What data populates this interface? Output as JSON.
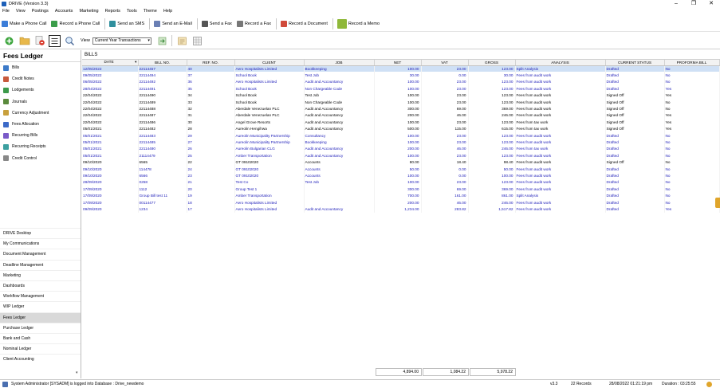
{
  "window": {
    "title": "DRIVE (Version 3.3)"
  },
  "menu": [
    "File",
    "View",
    "Postings",
    "Accounts",
    "Marketing",
    "Reports",
    "Tools",
    "Theme",
    "Help"
  ],
  "toolbar": [
    {
      "label": "Make a Phone Call",
      "icon": "phone-icon",
      "color": "#3b7dd8"
    },
    {
      "label": "Record a Phone Call",
      "icon": "phone-record-icon",
      "color": "#3b9d4a"
    },
    {
      "label": "Send an SMS",
      "icon": "sms-icon",
      "color": "#2f8f9d"
    },
    {
      "label": "Send an E-Mail",
      "icon": "email-icon",
      "color": "#6a7fb4"
    },
    {
      "label": "Send a Fax",
      "icon": "fax-icon",
      "color": "#555555"
    },
    {
      "label": "Record a Fax",
      "icon": "fax-record-icon",
      "color": "#777777"
    },
    {
      "label": "Record a Document",
      "icon": "document-icon",
      "color": "#d04a3a"
    },
    {
      "label": "Record a Memo",
      "icon": "memo-icon",
      "color": "#8fb83a"
    }
  ],
  "view": {
    "label": "View",
    "selected": "Current Year Transactions"
  },
  "sidebar": {
    "title": "Fees Ledger",
    "items": [
      {
        "label": "Bills",
        "icon": "bills-icon",
        "color": "#3c7ac8"
      },
      {
        "label": "Credit Notes",
        "icon": "credit-notes-icon",
        "color": "#c85a3c"
      },
      {
        "label": "Lodgements",
        "icon": "lodgements-icon",
        "color": "#3c9a4a"
      },
      {
        "label": "Journals",
        "icon": "journals-icon",
        "color": "#5a8a3c"
      },
      {
        "label": "Currency Adjustment",
        "icon": "currency-icon",
        "color": "#c8a03c"
      },
      {
        "label": "Fees Allocation",
        "icon": "allocation-icon",
        "color": "#3c6ac8"
      },
      {
        "label": "Recurring Bills",
        "icon": "recurring-bills-icon",
        "color": "#7a5ac8"
      },
      {
        "label": "Recurring Receipts",
        "icon": "recurring-receipts-icon",
        "color": "#3ca0a0"
      },
      {
        "label": "Credit Control",
        "icon": "credit-control-icon",
        "color": "#888888"
      }
    ],
    "nav": [
      "DRIVE Desktop",
      "My Communications",
      "Document Management",
      "Deadline Management",
      "Marketing",
      "Dashboards",
      "Workflow Management",
      "WIP Ledger",
      "Fees Ledger",
      "Purchase Ledger",
      "Bank and Cash",
      "Nominal Ledger",
      "Client Accounting"
    ],
    "active_nav": "Fees Ledger"
  },
  "main": {
    "title": "BILLS",
    "columns": [
      "DATE",
      "BILL NO.",
      "REF. NO.",
      "CLIENT",
      "JOB",
      "NET",
      "VAT",
      "GROSS",
      "ANALYSIS",
      "CURRENT STATUS",
      "PROFORMA BILL"
    ],
    "rows": [
      {
        "date": "12/05/2022",
        "bill": "22114457",
        "ref": "40",
        "client": "Aero Hospitalists Limited",
        "job": "Bookkeeping",
        "net": "100.00",
        "vat": "23.00",
        "gross": "123.00",
        "analysis": "Split Analysis",
        "status": "Drafted",
        "proforma": "No",
        "black": false,
        "sel": true
      },
      {
        "date": "09/05/2022",
        "bill": "22114494",
        "ref": "37",
        "client": "School Book",
        "job": "Test Job",
        "net": "30.00",
        "vat": "0.00",
        "gross": "30.00",
        "analysis": "Fees from audit work",
        "status": "Drafted",
        "proforma": "No",
        "black": false
      },
      {
        "date": "06/05/2022",
        "bill": "22114492",
        "ref": "36",
        "client": "Aero Hospitalists Limited",
        "job": "Audit and Accountancy",
        "net": "100.00",
        "vat": "23.00",
        "gross": "123.00",
        "analysis": "Fees from audit work",
        "status": "Drafted",
        "proforma": "No",
        "black": false
      },
      {
        "date": "28/04/2022",
        "bill": "22114491",
        "ref": "35",
        "client": "School Book",
        "job": "Non Chargeable Code",
        "net": "100.00",
        "vat": "23.00",
        "gross": "123.00",
        "analysis": "Fees from audit work",
        "status": "Drafted",
        "proforma": "Yes",
        "black": false
      },
      {
        "date": "22/04/2022",
        "bill": "22114490",
        "ref": "34",
        "client": "School Book",
        "job": "Test Job",
        "net": "100.00",
        "vat": "23.00",
        "gross": "123.00",
        "analysis": "Fees from audit work",
        "status": "Signed Off",
        "proforma": "Yes",
        "black": true
      },
      {
        "date": "22/04/2022",
        "bill": "22114489",
        "ref": "33",
        "client": "School Book",
        "job": "Non Chargeable Code",
        "net": "100.00",
        "vat": "23.00",
        "gross": "123.00",
        "analysis": "Fees from audit work",
        "status": "Signed Off",
        "proforma": "No",
        "black": true
      },
      {
        "date": "22/04/2022",
        "bill": "22114488",
        "ref": "32",
        "client": "Aberdale Venezuelan PLC",
        "job": "Audit and Accountancy",
        "net": "300.00",
        "vat": "69.00",
        "gross": "369.00",
        "analysis": "Fees from audit work",
        "status": "Signed Off",
        "proforma": "No",
        "black": true
      },
      {
        "date": "22/04/2022",
        "bill": "22114487",
        "ref": "31",
        "client": "Aberdale Venezuelan PLC",
        "job": "Audit and Accountancy",
        "net": "200.00",
        "vat": "46.00",
        "gross": "246.00",
        "analysis": "Fees from audit work",
        "status": "Signed Off",
        "proforma": "Yes",
        "black": true
      },
      {
        "date": "22/04/2022",
        "bill": "22114486",
        "ref": "30",
        "client": "Angel Grove Resorts",
        "job": "Audit and Accountancy",
        "net": "100.00",
        "vat": "23.00",
        "gross": "123.00",
        "analysis": "Fees from tax work",
        "status": "Signed Off",
        "proforma": "Yes",
        "black": true
      },
      {
        "date": "05/01/2021",
        "bill": "22114482",
        "ref": "28",
        "client": "Aureolin Hengihwa",
        "job": "Audit and Accountancy",
        "net": "500.00",
        "vat": "115.00",
        "gross": "615.00",
        "analysis": "Fees from tax work",
        "status": "Signed Off",
        "proforma": "Yes",
        "black": true
      },
      {
        "date": "05/01/2021",
        "bill": "22114483",
        "ref": "29",
        "client": "Aureolin Municipality Partnership",
        "job": "Consultancy",
        "net": "100.00",
        "vat": "23.00",
        "gross": "123.00",
        "analysis": "Fees from audit work",
        "status": "Drafted",
        "proforma": "No",
        "black": false
      },
      {
        "date": "05/01/2021",
        "bill": "22114485",
        "ref": "27",
        "client": "Aureolin Municipality Partnership",
        "job": "Bookkeeping",
        "net": "100.00",
        "vat": "23.00",
        "gross": "123.00",
        "analysis": "Fees from audit work",
        "status": "Drafted",
        "proforma": "No",
        "black": false
      },
      {
        "date": "05/01/2021",
        "bill": "22114480",
        "ref": "26",
        "client": "Aureolin Bulgarian CLG",
        "job": "Audit and Accountancy",
        "net": "200.00",
        "vat": "46.00",
        "gross": "246.00",
        "analysis": "Fees from tax work",
        "status": "Drafted",
        "proforma": "No",
        "black": false
      },
      {
        "date": "05/01/2021",
        "bill": "21114479",
        "ref": "25",
        "client": "Amber Transportation",
        "job": "Audit and Accountancy",
        "net": "100.00",
        "vat": "23.00",
        "gross": "123.00",
        "analysis": "Fees from audit work",
        "status": "Drafted",
        "proforma": "No",
        "black": false
      },
      {
        "date": "09/10/2020",
        "bill": "6565",
        "ref": "22",
        "client": "GT 09102020",
        "job": "Accounts",
        "net": "80.00",
        "vat": "18.40",
        "gross": "98.40",
        "analysis": "Fees from audit work",
        "status": "Signed Off",
        "proforma": "No",
        "black": true
      },
      {
        "date": "09/10/2020",
        "bill": "114478",
        "ref": "24",
        "client": "GT 09102020",
        "job": "Accounts",
        "net": "50.00",
        "vat": "0.00",
        "gross": "50.00",
        "analysis": "Fees from audit work",
        "status": "Drafted",
        "proforma": "No",
        "black": false
      },
      {
        "date": "09/10/2020",
        "bill": "6566",
        "ref": "23",
        "client": "GT 09102020",
        "job": "Accounts",
        "net": "100.00",
        "vat": "0.00",
        "gross": "100.00",
        "analysis": "Fees from audit work",
        "status": "Drafted",
        "proforma": "No",
        "black": false
      },
      {
        "date": "28/09/2020",
        "bill": "0258",
        "ref": "21",
        "client": "Test Co",
        "job": "Test Job",
        "net": "100.00",
        "vat": "23.00",
        "gross": "123.00",
        "analysis": "Fees from audit work",
        "status": "Drafted",
        "proforma": "No",
        "black": false
      },
      {
        "date": "17/09/2020",
        "bill": "1112",
        "ref": "20",
        "client": "Group Test 1",
        "job": "",
        "net": "300.00",
        "vat": "69.00",
        "gross": "369.00",
        "analysis": "Fees from audit work",
        "status": "Drafted",
        "proforma": "No",
        "black": false
      },
      {
        "date": "17/09/2020",
        "bill": "Group Bill test 11",
        "ref": "19",
        "client": "Amber Transportation",
        "job": "",
        "net": "700.00",
        "vat": "161.00",
        "gross": "861.00",
        "analysis": "Split Analysis",
        "status": "Drafted",
        "proforma": "No",
        "black": false
      },
      {
        "date": "17/09/2020",
        "bill": "00114477",
        "ref": "18",
        "client": "Aero Hospitalists Limited",
        "job": "",
        "net": "200.00",
        "vat": "46.00",
        "gross": "246.00",
        "analysis": "Fees from audit work",
        "status": "Drafted",
        "proforma": "No",
        "black": false
      },
      {
        "date": "09/09/2020",
        "bill": "1234",
        "ref": "17",
        "client": "Aero Hospitalists Limited",
        "job": "Audit and Accountancy",
        "net": "1,234.00",
        "vat": "283.82",
        "gross": "1,517.82",
        "analysis": "Fees from audit work",
        "status": "Drafted",
        "proforma": "Yes",
        "black": false
      }
    ],
    "totals": {
      "net": "4,894.00",
      "vat": "1,084.22",
      "gross": "5,978.22"
    }
  },
  "status": {
    "login": "System Administrator [SYSADM] is logged into Database : Drive_newdemo",
    "version": "v3.3",
    "records": "22 Records",
    "datetime": "28/08/2022 01:21:19 pm",
    "duration": "Duration : 03:25:55"
  }
}
